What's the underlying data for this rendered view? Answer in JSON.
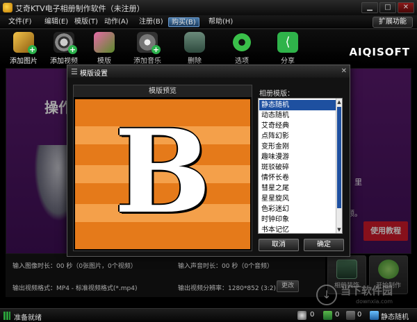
{
  "window": {
    "title": "艾奇KTV电子相册制作软件（未注册）"
  },
  "menu": {
    "items": [
      "文件(F)",
      "编辑(E)",
      "模版(T)",
      "动作(A)",
      "注册(B)",
      "购买(B)",
      "帮助(H)"
    ],
    "active_index": 5,
    "extend_label": "扩展功能"
  },
  "toolbar": {
    "items": [
      {
        "label": "添加图片",
        "icon": "add-photo-icon"
      },
      {
        "label": "添加视频",
        "icon": "add-video-icon"
      },
      {
        "label": "模版",
        "icon": "template-icon"
      },
      {
        "label": "添加音乐",
        "icon": "add-music-icon"
      },
      {
        "label": "删除",
        "icon": "trash-icon"
      },
      {
        "label": "选项",
        "icon": "settings-gear-icon"
      },
      {
        "label": "分享",
        "icon": "share-icon"
      }
    ],
    "brand": "AIQISOFT"
  },
  "workarea": {
    "heading": "操作",
    "hint_tail1": "里",
    "hint_tail2": "频。",
    "tutorial_label": "使用教程"
  },
  "dialog": {
    "title": "模版设置",
    "preview_label": "模版预览",
    "preview_glyph": "B",
    "list_label": "相册模版：",
    "templates": [
      "静态随机",
      "动态随机",
      "艾奇经典",
      "点阵幻影",
      "变形金刚",
      "趣味漫游",
      "斑驳破碎",
      "情怀长卷",
      "彗星之尾",
      "星星旋风",
      "色彩迷幻",
      "时钟印象",
      "书本记忆"
    ],
    "selected_index": 0,
    "cancel_label": "取消",
    "ok_label": "确定"
  },
  "info": {
    "image_duration": "输入图像时长：00 秒（0张图片，0个视频）",
    "audio_duration": "输入声音时长：00 秒（0个音频）",
    "output_format": "输出视频格式：MP4 - 标准视频格式(*.mp4)",
    "output_resolution": "输出视频分辨率：1280*852 (3:2)",
    "change_label": "更改"
  },
  "actions": {
    "decorate_label": "相册装饰",
    "start_label": "开始制作"
  },
  "status": {
    "text": "准备就绪",
    "counts": [
      "0",
      "0",
      "0",
      "0"
    ],
    "template_name": "静态随机"
  },
  "watermark": {
    "text": "当下软件园",
    "url": "downxia.com"
  },
  "colors": {
    "workarea": "#4a1560",
    "selection": "#1e50a0",
    "tutorial": "#d01a2a",
    "preview_orange": "#e57a1a"
  }
}
